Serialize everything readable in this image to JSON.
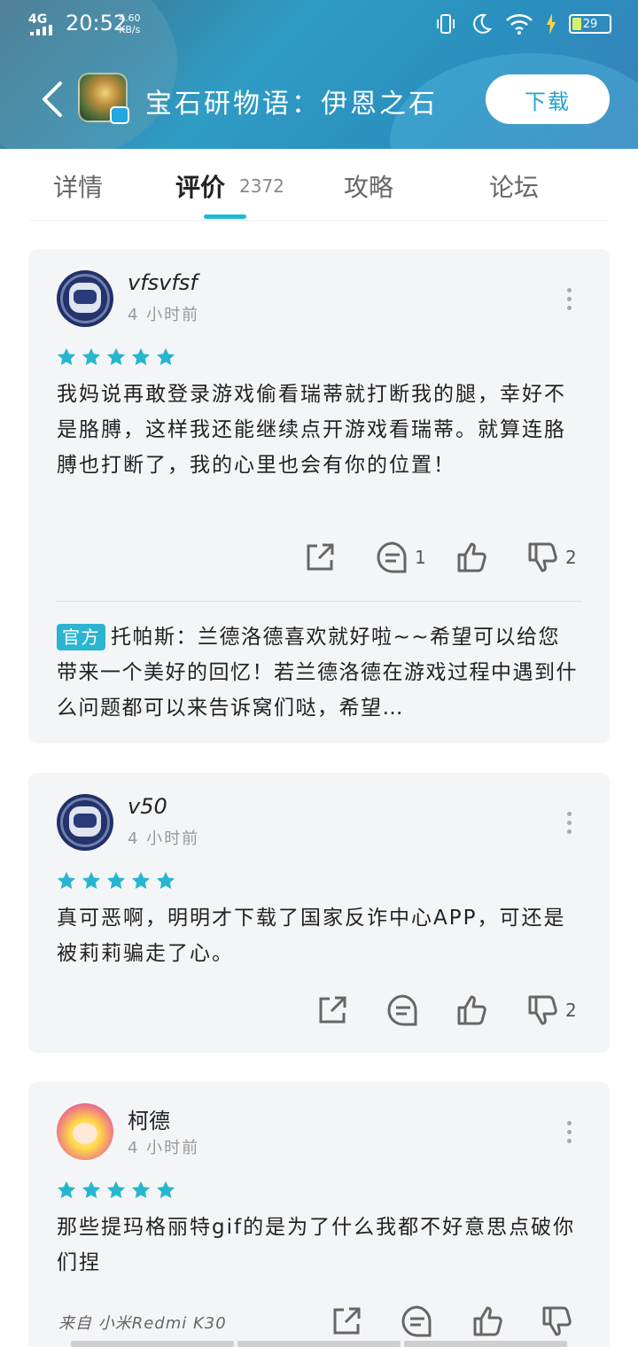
{
  "status_bar": {
    "network": "4G",
    "time": "20:52",
    "speed_value": "4.60",
    "speed_unit": "KB/s",
    "battery": "29"
  },
  "header": {
    "app_title": "宝石研物语：伊恩之石",
    "download_label": "下载"
  },
  "tabs": [
    {
      "label": "详情"
    },
    {
      "label": "评价",
      "count": "2372",
      "active": true
    },
    {
      "label": "攻略"
    },
    {
      "label": "论坛"
    }
  ],
  "reviews": [
    {
      "username": "vfsvfsf",
      "time": "4 小时前",
      "rating": 5,
      "text": "我妈说再敢登录游戏偷看瑞蒂就打断我的腿，幸好不是胳膊，这样我还能继续点开游戏看瑞蒂。就算连胳膊也打断了，我的心里也会有你的位置！",
      "comments": "1",
      "likes": "",
      "dislikes": "2",
      "reply": {
        "tag": "官方",
        "author": "托帕斯：",
        "text": "兰德洛德喜欢就好啦~~希望可以给您带来一个美好的回忆！若兰德洛德在游戏过程中遇到什么问题都可以来告诉窝们哒，希望…"
      }
    },
    {
      "username": "v50",
      "time": "4 小时前",
      "rating": 5,
      "text": "真可恶啊，明明才下载了国家反诈中心APP，可还是被莉莉骗走了心。",
      "comments": "",
      "likes": "",
      "dislikes": "2"
    },
    {
      "username": "柯德",
      "time": "4 小时前",
      "rating": 5,
      "text": "那些提玛格丽特gif的是为了什么我都不好意思点破你们捏",
      "device": "来自 小米Redmi K30"
    }
  ],
  "colors": {
    "accent": "#1fb8d4",
    "star": "#26b6cf",
    "card_bg": "#f4f5f7"
  }
}
